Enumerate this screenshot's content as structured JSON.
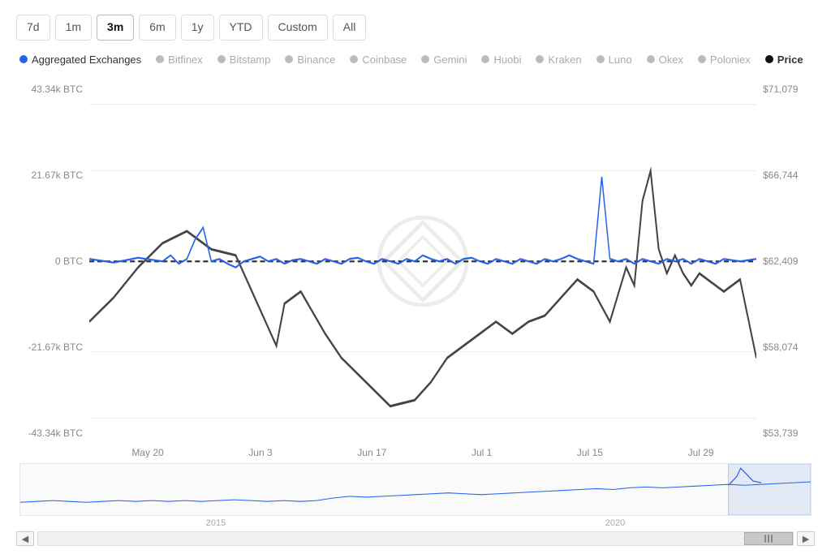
{
  "timeRange": {
    "buttons": [
      "7d",
      "1m",
      "3m",
      "6m",
      "1y",
      "YTD",
      "Custom",
      "All"
    ],
    "active": "3m"
  },
  "legend": {
    "items": [
      {
        "id": "aggregated",
        "label": "Aggregated Exchanges",
        "color": "#2563eb",
        "active": true
      },
      {
        "id": "bitfinex",
        "label": "Bitfinex",
        "color": "#bbb",
        "active": false
      },
      {
        "id": "bitstamp",
        "label": "Bitstamp",
        "color": "#bbb",
        "active": false
      },
      {
        "id": "binance",
        "label": "Binance",
        "color": "#bbb",
        "active": false
      },
      {
        "id": "coinbase",
        "label": "Coinbase",
        "color": "#bbb",
        "active": false
      },
      {
        "id": "gemini",
        "label": "Gemini",
        "color": "#bbb",
        "active": false
      },
      {
        "id": "huobi",
        "label": "Huobi",
        "color": "#bbb",
        "active": false
      },
      {
        "id": "kraken",
        "label": "Kraken",
        "color": "#bbb",
        "active": false
      },
      {
        "id": "luno",
        "label": "Luno",
        "color": "#bbb",
        "active": false
      },
      {
        "id": "okex",
        "label": "Okex",
        "color": "#bbb",
        "active": false
      },
      {
        "id": "poloniex",
        "label": "Poloniex",
        "color": "#bbb",
        "active": false
      },
      {
        "id": "price",
        "label": "Price",
        "color": "#111",
        "active": true,
        "isPrice": true
      }
    ]
  },
  "yAxisLeft": [
    "43.34k BTC",
    "21.67k BTC",
    "0 BTC",
    "-21.67k BTC",
    "-43.34k BTC"
  ],
  "yAxisRight": [
    "$71,079",
    "$66,744",
    "$62,409",
    "$58,074",
    "$53,739"
  ],
  "xAxisLabels": [
    "May 20",
    "Jun 3",
    "Jun 17",
    "Jul 1",
    "Jul 15",
    "Jul 29"
  ],
  "overviewLabels": [
    "2015",
    "2020"
  ],
  "watermark": "IntoTheBlock"
}
